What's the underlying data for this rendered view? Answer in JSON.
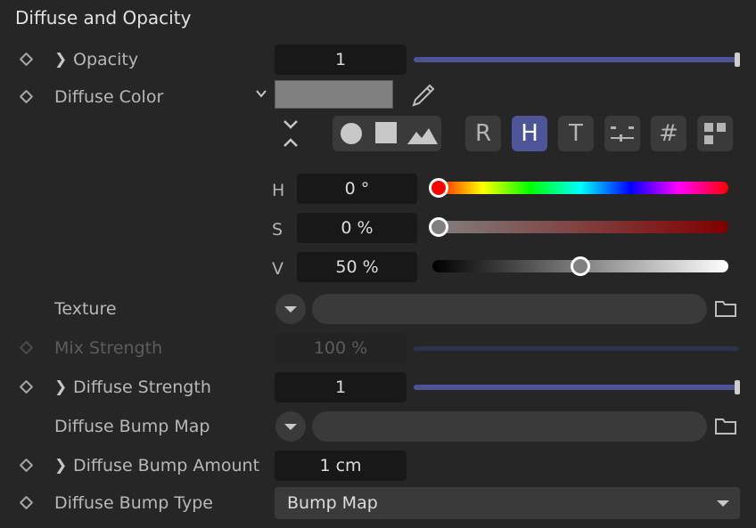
{
  "section_title": "Diffuse and Opacity",
  "opacity": {
    "label": "Opacity",
    "value": "1",
    "slider_fraction": 1.0
  },
  "diffuse_color": {
    "label": "Diffuse Color",
    "swatch_color": "#808080"
  },
  "color_modes": {
    "r_label": "R",
    "h_label": "H",
    "t_label": "T",
    "hash_label": "#",
    "active_mode": "H",
    "accent_color": "#4d5498"
  },
  "hsv": {
    "h": {
      "label": "H",
      "value": "0 °",
      "fraction": 0.0
    },
    "s": {
      "label": "S",
      "value": "0 %",
      "fraction": 0.0
    },
    "v": {
      "label": "V",
      "value": "50 %",
      "fraction": 0.5
    }
  },
  "texture": {
    "label": "Texture"
  },
  "mix_strength": {
    "label": "Mix Strength",
    "value": "100 %",
    "enabled": false
  },
  "diffuse_strength": {
    "label": "Diffuse Strength",
    "value": "1",
    "slider_fraction": 1.0
  },
  "diffuse_bump_map": {
    "label": "Diffuse Bump Map"
  },
  "diffuse_bump_amount": {
    "label": "Diffuse Bump Amount",
    "value": "1 cm"
  },
  "diffuse_bump_type": {
    "label": "Diffuse Bump Type",
    "value": "Bump Map"
  },
  "icons": {
    "keyframe": "diamond-icon",
    "expand": "chevron-right-icon",
    "eyedropper": "eyedropper-icon",
    "folder": "folder-icon",
    "dropdown": "chevron-down-icon"
  }
}
